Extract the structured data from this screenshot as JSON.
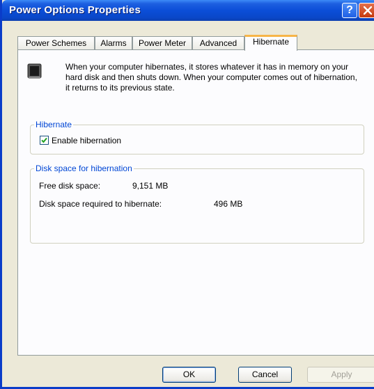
{
  "window": {
    "title": "Power Options Properties",
    "help_label": "?",
    "accent": "#0a47c8"
  },
  "tabs": [
    {
      "label": "Power Schemes",
      "active": false
    },
    {
      "label": "Alarms",
      "active": false
    },
    {
      "label": "Power Meter",
      "active": false
    },
    {
      "label": "Advanced",
      "active": false
    },
    {
      "label": "Hibernate",
      "active": true
    }
  ],
  "intro": {
    "icon": "hibernate-icon",
    "text": "When your computer hibernates, it stores whatever it has in memory on your hard disk and then shuts down. When your computer comes out of hibernation, it returns to its previous state."
  },
  "hibernate_group": {
    "legend": "Hibernate",
    "checkbox_label": "Enable hibernation",
    "checked": true
  },
  "disk_group": {
    "legend": "Disk space for hibernation",
    "free_label": "Free disk space:",
    "free_value": "9,151 MB",
    "required_label": "Disk space required to hibernate:",
    "required_value": "496 MB"
  },
  "buttons": {
    "ok": "OK",
    "cancel": "Cancel",
    "apply": "Apply"
  }
}
